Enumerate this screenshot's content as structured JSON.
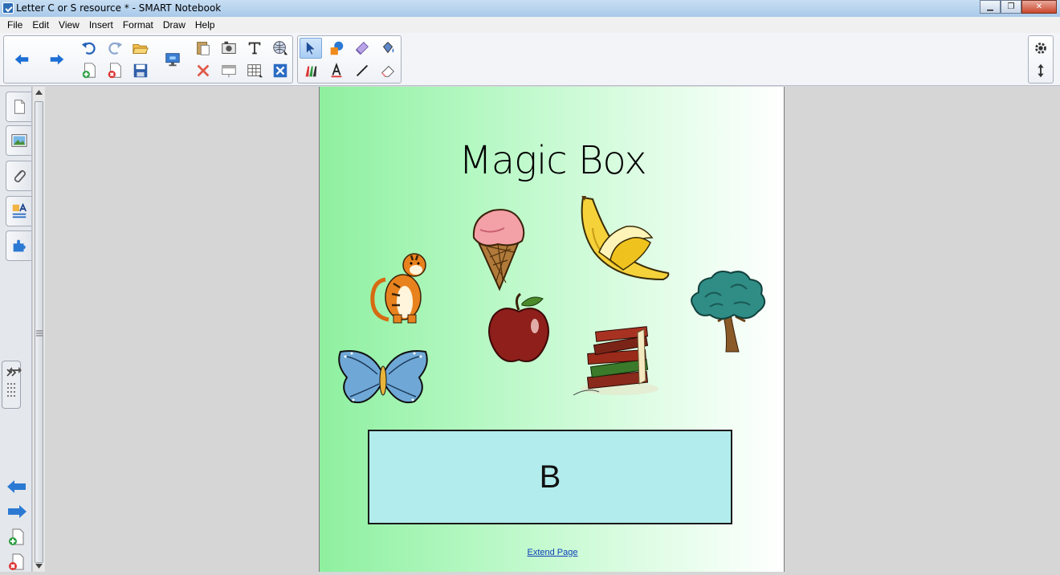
{
  "window": {
    "title": "Letter C or S resource * - SMART Notebook"
  },
  "menu": [
    "File",
    "Edit",
    "View",
    "Insert",
    "Format",
    "Draw",
    "Help"
  ],
  "toolbar": {
    "icons": [
      "back-arrow",
      "forward-arrow",
      "undo",
      "redo",
      "open-file",
      "add-page",
      "delete-page",
      "save",
      "screen-shade",
      "paste",
      "delete",
      "screen-capture",
      "table",
      "text",
      "clear-ink",
      "select",
      "shapes",
      "fill",
      "properties",
      "pens",
      "text-tool",
      "line",
      "eraser"
    ]
  },
  "page": {
    "title": "Magic Box",
    "answer_letter": "B",
    "extend_link": "Extend Page"
  },
  "pictures": [
    "tiger",
    "ice-cream",
    "banana",
    "tree",
    "apple",
    "butterfly",
    "books"
  ],
  "colors": {
    "page_gradient_start": "#8ef09f",
    "answer_box": "#b2ecec",
    "link": "#0b3fb8"
  }
}
